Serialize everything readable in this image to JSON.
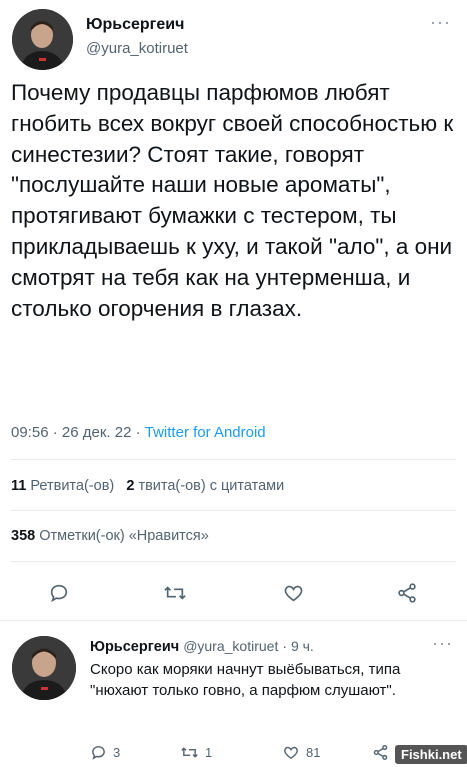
{
  "tweet": {
    "author_name": "Юрьсергеич",
    "author_handle": "@yura_kotiruet",
    "text": "Почему продавцы парфюмов любят гнобить всех вокруг своей способностью к синестезии? Стоят такие, говорят \"послушайте наши новые ароматы\", протягивают бумажки с тестером, ты прикладываешь к уху, и такой \"ало\", а они смотрят на тебя как на унтерменша, и столько огорчения в глазах.",
    "time": "09:56",
    "date": "26 дек. 22",
    "source": "Twitter for Android",
    "retweets_count": "11",
    "retweets_label": "Ретвита(-ов)",
    "quotes_count": "2",
    "quotes_label": "твита(-ов) с цитатами",
    "likes_count": "358",
    "likes_label": "Отметки(-ок) «Нравится»"
  },
  "reply": {
    "author_name": "Юрьсергеич",
    "author_handle": "@yura_kotiruet",
    "time_ago": "9 ч.",
    "text": "Скоро как моряки начнут выёбываться, типа \"нюхают только говно, а парфюм слушают\".",
    "reply_count": "3",
    "retweet_count": "1",
    "like_count": "81"
  },
  "watermark": "Fishki.net",
  "icons": [
    "reply-icon",
    "retweet-icon",
    "like-icon",
    "share-icon",
    "more-icon"
  ]
}
